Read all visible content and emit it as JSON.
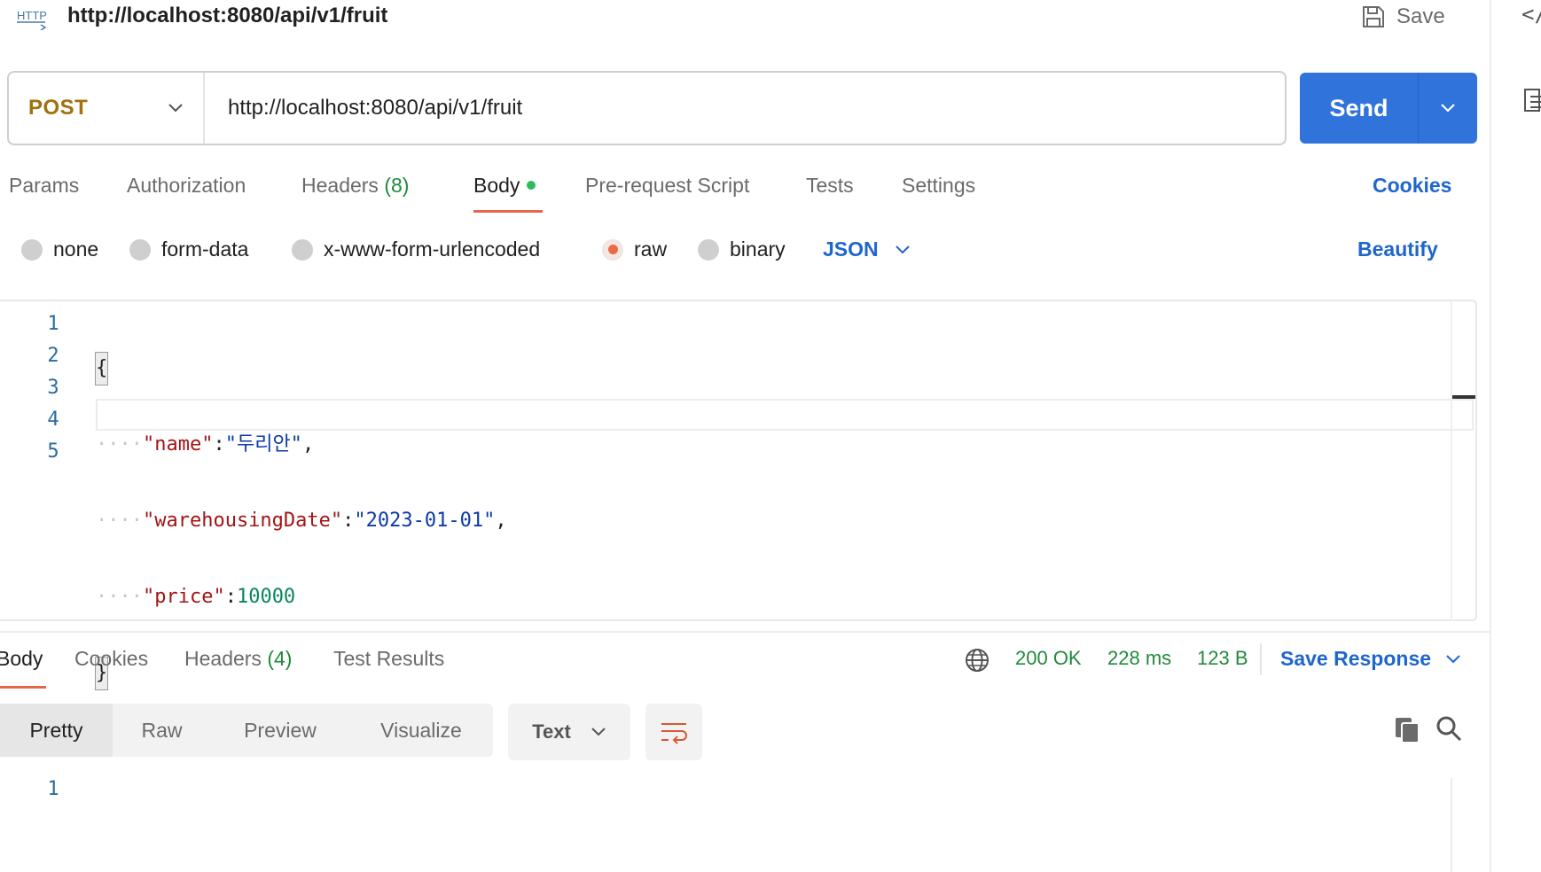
{
  "request": {
    "icon_label": "HTTP",
    "title": "http://localhost:8080/api/v1/fruit",
    "save_label": "Save",
    "method": "POST",
    "url": "http://localhost:8080/api/v1/fruit",
    "send_label": "Send"
  },
  "right_rail": {
    "code_label": "</"
  },
  "request_tabs": {
    "params": "Params",
    "authorization": "Authorization",
    "headers": "Headers",
    "headers_count": "(8)",
    "body": "Body",
    "pre_request": "Pre-request Script",
    "tests": "Tests",
    "settings": "Settings",
    "cookies": "Cookies"
  },
  "body_types": {
    "none": "none",
    "form_data": "form-data",
    "urlencoded": "x-www-form-urlencoded",
    "raw": "raw",
    "binary": "binary",
    "selected": "raw",
    "format": "JSON",
    "beautify": "Beautify"
  },
  "editor": {
    "line_numbers": [
      "1",
      "2",
      "3",
      "4",
      "5"
    ],
    "brace_open": "{",
    "brace_close": "}",
    "indent": "····",
    "key_name": "\"name\"",
    "value_name": "\"두리안\"",
    "key_date": "\"warehousingDate\"",
    "value_date": "\"2023-01-01\"",
    "key_price": "\"price\"",
    "value_price": "10000",
    "colon": ":",
    "comma": ","
  },
  "response_tabs": {
    "body": "Body",
    "cookies": "Cookies",
    "headers": "Headers",
    "headers_count": "(4)",
    "test_results": "Test Results"
  },
  "response_status": {
    "status": "200 OK",
    "time": "228 ms",
    "size": "123 B",
    "save_response": "Save Response"
  },
  "response_view": {
    "pretty": "Pretty",
    "raw": "Raw",
    "preview": "Preview",
    "visualize": "Visualize",
    "format": "Text",
    "line_numbers": [
      "1"
    ]
  },
  "colors": {
    "accent_blue": "#2f73db",
    "link_blue": "#1f66cc",
    "method_post": "#a1710d",
    "status_green": "#208a3c",
    "active_orange": "#e8664a"
  }
}
